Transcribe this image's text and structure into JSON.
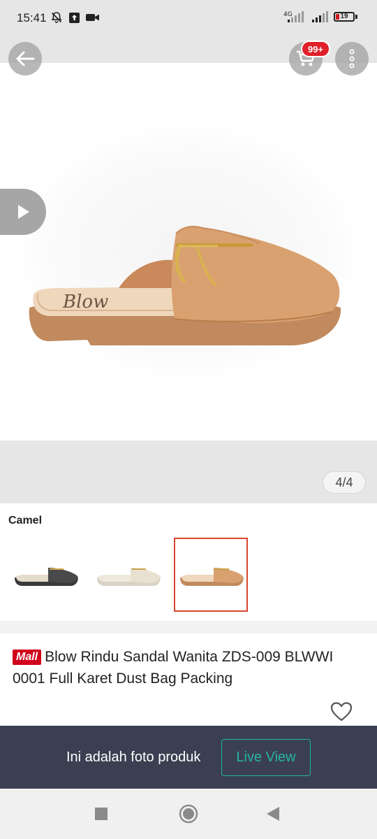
{
  "status_bar": {
    "time": "15:41",
    "network": "4G",
    "battery": "19",
    "battery_level_pct": 19,
    "battery_color": "#d01818"
  },
  "header": {
    "back_icon": "arrow-left-icon",
    "cart_icon": "cart-icon",
    "cart_badge": "99+",
    "cart_badge_color": "#e0202a",
    "more_icon": "more-vertical-icon"
  },
  "gallery": {
    "video_icon": "play-icon",
    "page_counter": "4/4",
    "photo_brand_text": "Blow"
  },
  "variants": {
    "label": "Camel",
    "items": [
      {
        "color_name": "black",
        "selected": false
      },
      {
        "color_name": "cream",
        "selected": false
      },
      {
        "color_name": "camel",
        "selected": true
      }
    ],
    "selected_border_color": "#d9462e"
  },
  "product": {
    "mall_badge": "Mall",
    "title": "Blow Rindu Sandal Wanita ZDS-009 BLWWI 0001 Full Karet Dust Bag Packing",
    "favorite_icon": "heart-outline-icon",
    "mall_color": "#d0011b"
  },
  "info_bar": {
    "text": "Ini adalah foto produk",
    "live_view_label": "Live View",
    "accent": "#26b3a3"
  },
  "nav_bar": {
    "recents_icon": "square-icon",
    "home_icon": "circle-icon",
    "back_icon": "triangle-back-icon"
  }
}
